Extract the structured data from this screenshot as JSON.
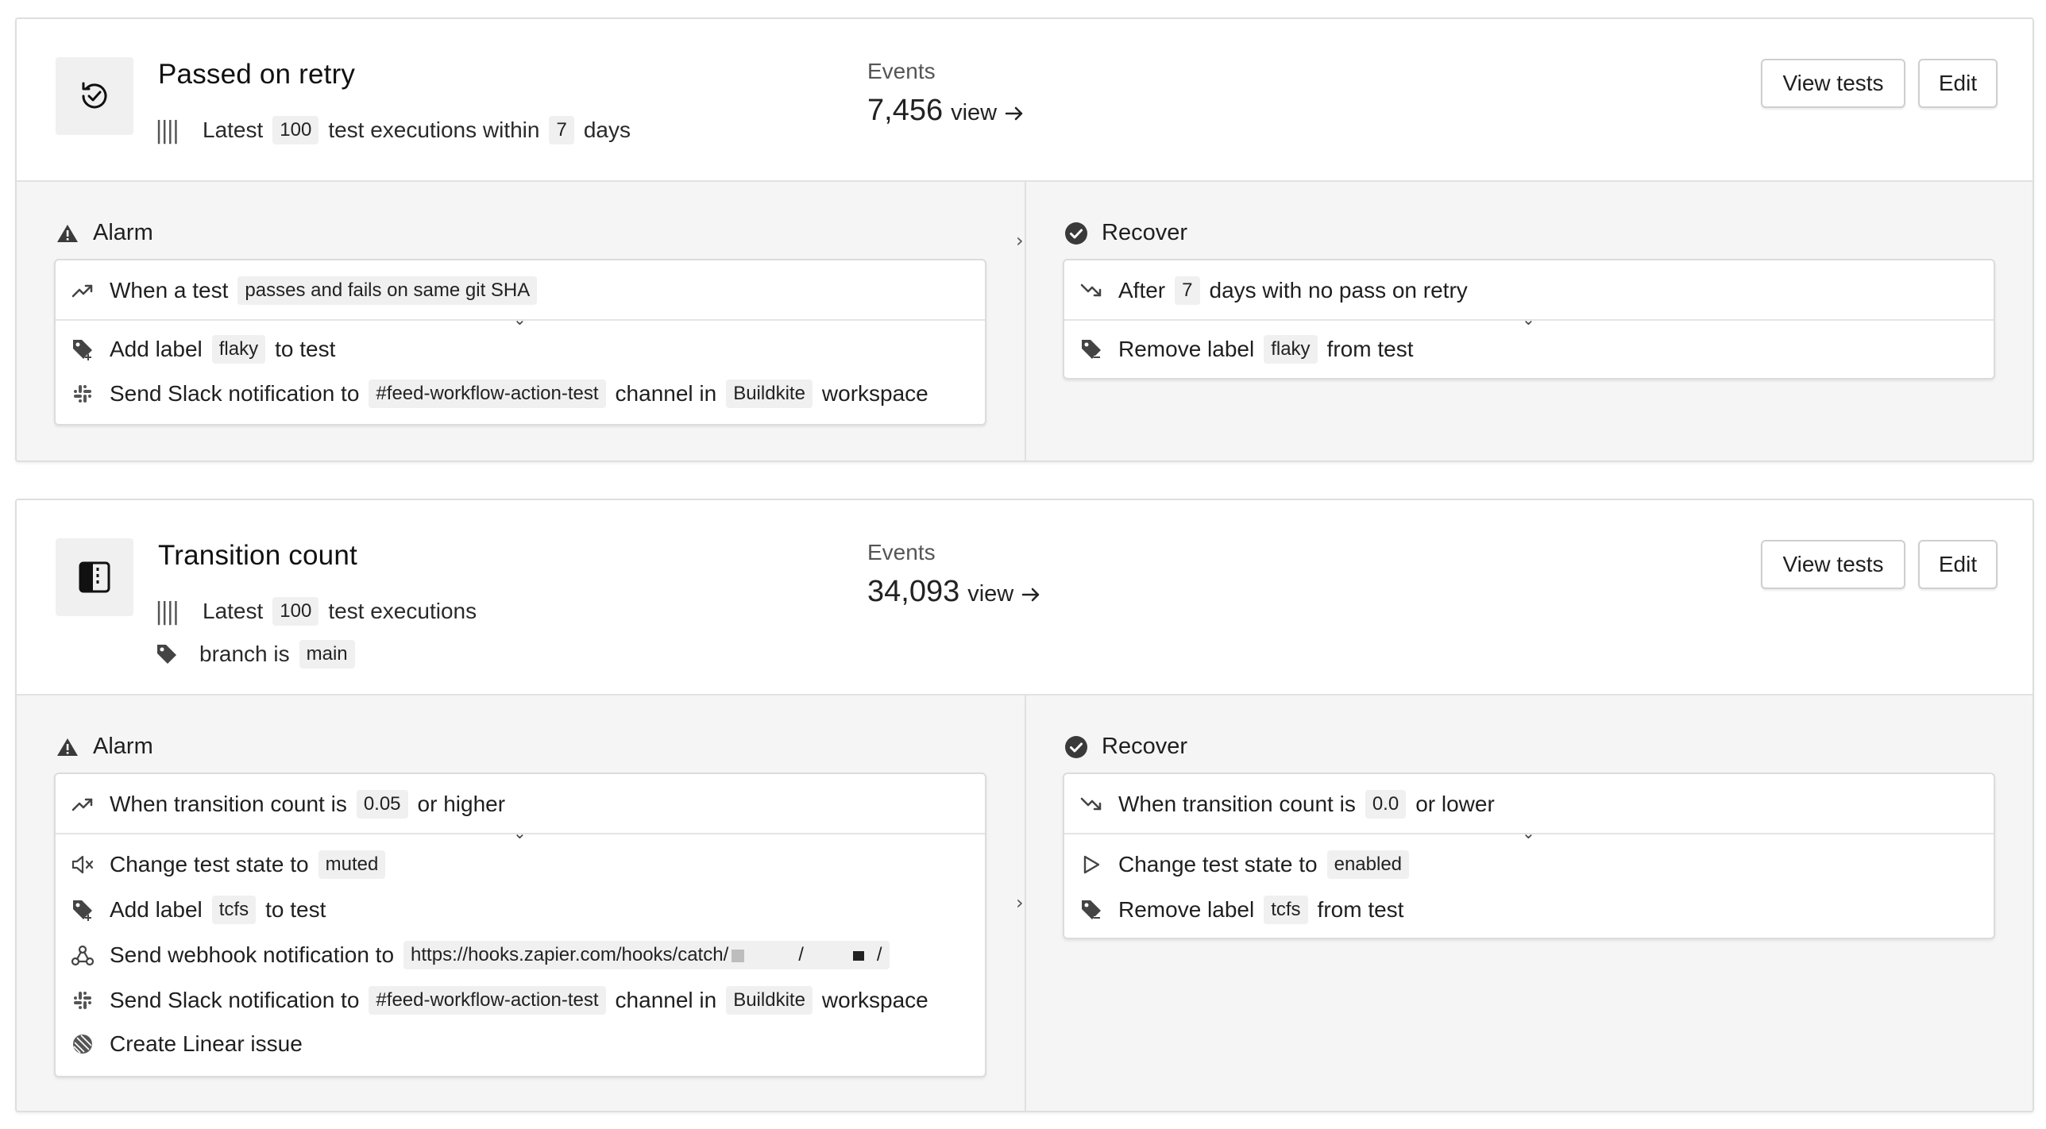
{
  "monitors": [
    {
      "title": "Passed on retry",
      "icon": "retry-check-icon",
      "sub_prefix": "Latest",
      "sub_count": "100",
      "sub_mid": "test executions within",
      "sub_days": "7",
      "sub_suffix": "days",
      "events_label": "Events",
      "events_count": "7,456",
      "events_view": "view",
      "view_tests_label": "View tests",
      "edit_label": "Edit",
      "alarm": {
        "heading": "Alarm",
        "trigger_prefix": "When a test",
        "trigger_value": "passes and fails on same git SHA",
        "actions": [
          {
            "icon": "tag-add-icon",
            "prefix": "Add label",
            "value": "flaky",
            "suffix": "to test"
          },
          {
            "icon": "slack-icon",
            "prefix": "Send Slack notification to",
            "value": "#feed-workflow-action-test",
            "mid": "channel in",
            "value2": "Buildkite",
            "suffix": "workspace"
          }
        ]
      },
      "recover": {
        "heading": "Recover",
        "trigger_prefix": "After",
        "trigger_value": "7",
        "trigger_suffix": "days with no pass on retry",
        "actions": [
          {
            "icon": "tag-remove-icon",
            "prefix": "Remove label",
            "value": "flaky",
            "suffix": "from test"
          }
        ]
      }
    },
    {
      "title": "Transition count",
      "icon": "transition-icon",
      "sub_prefix": "Latest",
      "sub_count": "100",
      "sub_mid": "test executions",
      "filter_prefix": "branch is",
      "filter_value": "main",
      "events_label": "Events",
      "events_count": "34,093",
      "events_view": "view",
      "view_tests_label": "View tests",
      "edit_label": "Edit",
      "alarm": {
        "heading": "Alarm",
        "trigger_prefix": "When transition count is",
        "trigger_value": "0.05",
        "trigger_suffix": "or higher",
        "actions": [
          {
            "icon": "mute-icon",
            "prefix": "Change test state to",
            "value": "muted"
          },
          {
            "icon": "tag-add-icon",
            "prefix": "Add label",
            "value": "tcfs",
            "suffix": "to test"
          },
          {
            "icon": "webhook-icon",
            "prefix": "Send webhook notification to",
            "value": "https://hooks.zapier.com/hooks/catch/"
          },
          {
            "icon": "slack-icon",
            "prefix": "Send Slack notification to",
            "value": "#feed-workflow-action-test",
            "mid": "channel in",
            "value2": "Buildkite",
            "suffix": "workspace"
          },
          {
            "icon": "linear-icon",
            "prefix": "Create Linear issue"
          }
        ]
      },
      "recover": {
        "heading": "Recover",
        "trigger_prefix": "When transition count is",
        "trigger_value": "0.0",
        "trigger_suffix": "or lower",
        "actions": [
          {
            "icon": "play-icon",
            "prefix": "Change test state to",
            "value": "enabled"
          },
          {
            "icon": "tag-remove-icon",
            "prefix": "Remove label",
            "value": "tcfs",
            "suffix": "from test"
          }
        ]
      }
    }
  ]
}
